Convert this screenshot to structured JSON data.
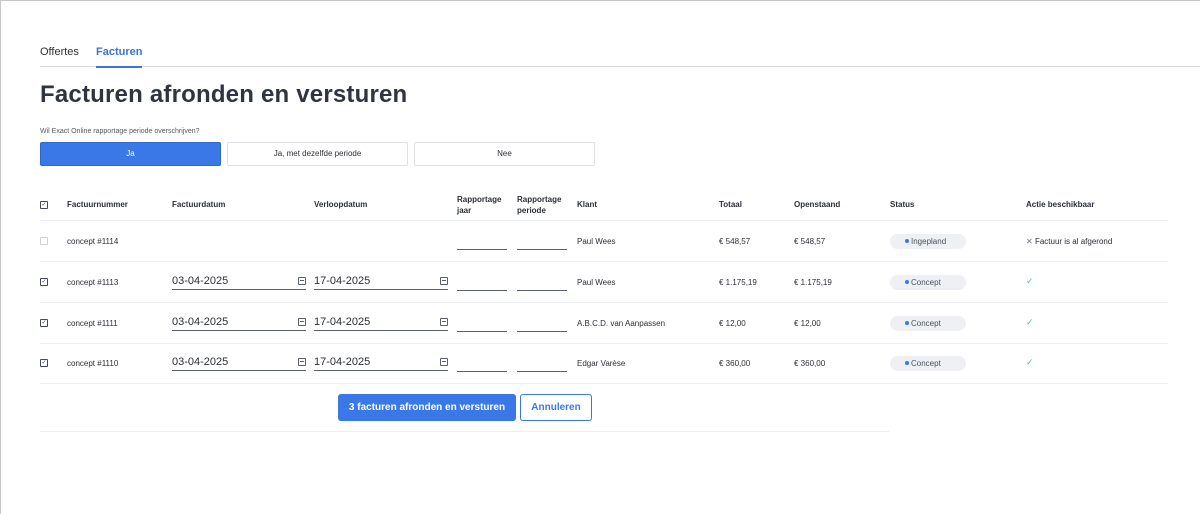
{
  "tabs": [
    {
      "label": "Offertes"
    },
    {
      "label": "Facturen"
    }
  ],
  "page_title": "Facturen afronden en versturen",
  "question": "Wil Exact Online rapportage periode overschrijven?",
  "choices": [
    {
      "label": "Ja",
      "selected": true
    },
    {
      "label": "Ja, met dezelfde periode",
      "selected": false
    },
    {
      "label": "Nee",
      "selected": false
    }
  ],
  "table": {
    "header_checkbox": "✓",
    "columns": {
      "nummer": "Factuurnummer",
      "datum": "Factuurdatum",
      "verloop": "Verloopdatum",
      "rap_jaar_1": "Rapportage",
      "rap_jaar_2": "jaar",
      "rap_periode_1": "Rapportage",
      "rap_periode_2": "periode",
      "klant": "Klant",
      "totaal": "Totaal",
      "openstaand": "Openstaand",
      "status": "Status",
      "actie": "Actie beschikbaar"
    },
    "rows": [
      {
        "checked": false,
        "nummer": "concept #1114",
        "datum": "",
        "verloop": "",
        "klant": "Paul Wees",
        "totaal": "€ 548,57",
        "openstaand": "€ 548,57",
        "status": "Ingepland",
        "actie_icon": "✕",
        "actie": "Factuur is al afgerond"
      },
      {
        "checked": true,
        "nummer": "concept #1113",
        "datum": "03-04-2025",
        "verloop": "17-04-2025",
        "klant": "Paul Wees",
        "totaal": "€ 1.175,19",
        "openstaand": "€ 1.175,19",
        "status": "Concept",
        "actie_icon": "✓",
        "actie": ""
      },
      {
        "checked": true,
        "nummer": "concept #1111",
        "datum": "03-04-2025",
        "verloop": "17-04-2025",
        "klant": "A.B.C.D. van Aanpassen",
        "totaal": "€ 12,00",
        "openstaand": "€ 12,00",
        "status": "Concept",
        "actie_icon": "✓",
        "actie": ""
      },
      {
        "checked": true,
        "nummer": "concept #1110",
        "datum": "03-04-2025",
        "verloop": "17-04-2025",
        "klant": "Edgar Varèse",
        "totaal": "€ 360,00",
        "openstaand": "€ 360,00",
        "status": "Concept",
        "actie_icon": "✓",
        "actie": ""
      }
    ]
  },
  "buttons": {
    "submit": "3 facturen afronden en versturen",
    "cancel": "Annuleren"
  },
  "colors": {
    "accent": "#3b78e7",
    "check": "#4fbf9f"
  }
}
